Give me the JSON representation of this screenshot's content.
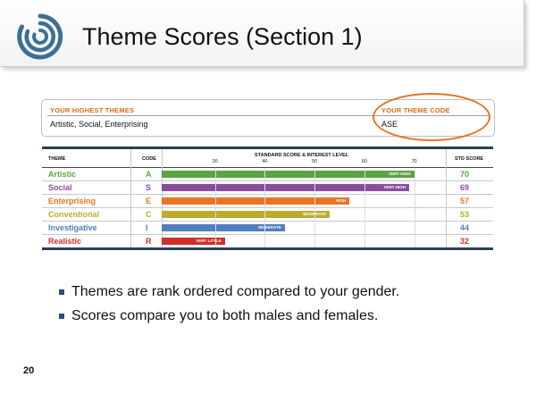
{
  "slide": {
    "title": "Theme Scores (Section 1)",
    "page_number": "20"
  },
  "summary": {
    "highest_label": "YOUR HIGHEST THEMES",
    "highest_value": "Artistic, Social, Enterprising",
    "code_label": "YOUR THEME CODE",
    "code_value": "ASE",
    "accent_color": "#e06a18"
  },
  "table": {
    "headers": {
      "theme": "THEME",
      "code": "CODE",
      "level": "STANDARD SCORE & INTEREST LEVEL",
      "score": "STD SCORE"
    },
    "scale_ticks": [
      "30",
      "40",
      "50",
      "60",
      "70"
    ],
    "scale_range": [
      20,
      76
    ],
    "rows": [
      {
        "theme": "Artistic",
        "code": "A",
        "score": "70",
        "score_value": 70,
        "level": "VERY HIGH",
        "color": "#5aa443"
      },
      {
        "theme": "Social",
        "code": "S",
        "score": "69",
        "score_value": 69,
        "level": "VERY HIGH",
        "color": "#8a4ca0"
      },
      {
        "theme": "Enterprising",
        "code": "E",
        "score": "57",
        "score_value": 57,
        "level": "HIGH",
        "color": "#ec7321"
      },
      {
        "theme": "Conventional",
        "code": "C",
        "score": "53",
        "score_value": 53,
        "level": "MODERATE",
        "color": "#bcac2c"
      },
      {
        "theme": "Investigative",
        "code": "I",
        "score": "44",
        "score_value": 44,
        "level": "MODERATE",
        "color": "#4f7fc0"
      },
      {
        "theme": "Realistic",
        "code": "R",
        "score": "32",
        "score_value": 32,
        "level": "VERY LITTLE",
        "color": "#d32d27"
      }
    ]
  },
  "bullets": [
    "Themes are rank ordered compared to your gender.",
    "Scores compare you to both males and females."
  ]
}
